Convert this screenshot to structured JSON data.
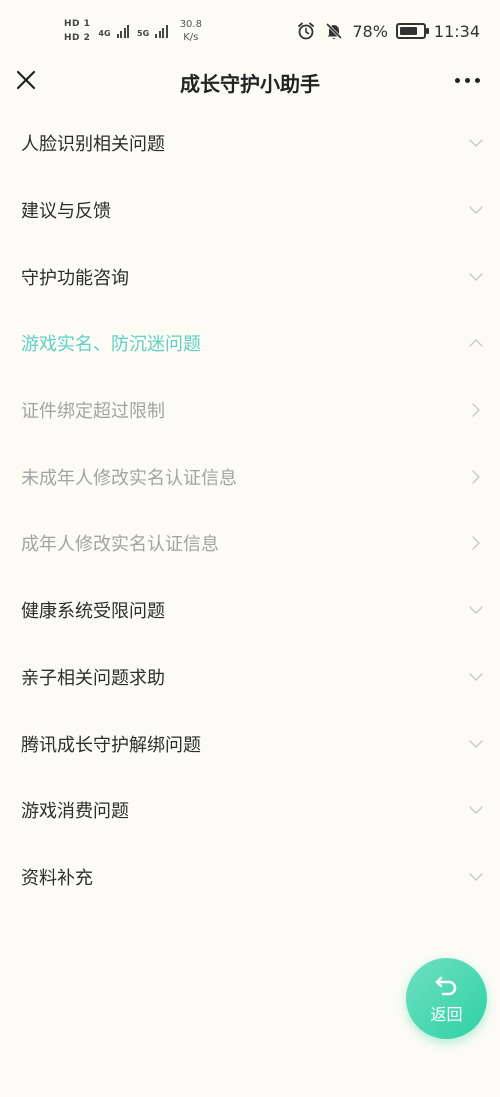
{
  "status_bar": {
    "sim1_label": "HD 1",
    "sim2_label": "HD 2",
    "net1_label": "4G",
    "net2_label": "5G",
    "speed_value": "30.8",
    "speed_unit": "K/s",
    "alarm_icon": "alarm-icon",
    "mute_icon": "bell-off-icon",
    "battery_percent_text": "78%",
    "battery_level": 0.78,
    "time": "11:34"
  },
  "header": {
    "title": "成长守护小助手",
    "close_icon": "close-icon",
    "more_icon": "more-icon"
  },
  "menu": [
    {
      "label": "人脸识别相关问题",
      "state": "collapsed",
      "icon": "chevron-down-icon"
    },
    {
      "label": "建议与反馈",
      "state": "collapsed",
      "icon": "chevron-down-icon"
    },
    {
      "label": "守护功能咨询",
      "state": "collapsed",
      "icon": "chevron-down-icon"
    },
    {
      "label": "游戏实名、防沉迷问题",
      "state": "expanded",
      "icon": "chevron-up-icon"
    },
    {
      "label": "证件绑定超过限制",
      "state": "sub",
      "icon": "chevron-right-icon"
    },
    {
      "label": "未成年人修改实名认证信息",
      "state": "sub",
      "icon": "chevron-right-icon"
    },
    {
      "label": "成年人修改实名认证信息",
      "state": "sub",
      "icon": "chevron-right-icon"
    },
    {
      "label": "健康系统受限问题",
      "state": "collapsed",
      "icon": "chevron-down-icon"
    },
    {
      "label": "亲子相关问题求助",
      "state": "collapsed",
      "icon": "chevron-down-icon"
    },
    {
      "label": "腾讯成长守护解绑问题",
      "state": "collapsed",
      "icon": "chevron-down-icon"
    },
    {
      "label": "游戏消费问题",
      "state": "collapsed",
      "icon": "chevron-down-icon"
    },
    {
      "label": "资料补充",
      "state": "collapsed",
      "icon": "chevron-down-icon"
    }
  ],
  "fab": {
    "label": "返回",
    "icon": "return-arrow-icon"
  },
  "colors": {
    "background": "#fcfcf5",
    "accent": "#5fcfc8",
    "fab": "#2fd1a4",
    "muted_text": "#a3a3a3",
    "chevron": "#c8c8c8"
  }
}
